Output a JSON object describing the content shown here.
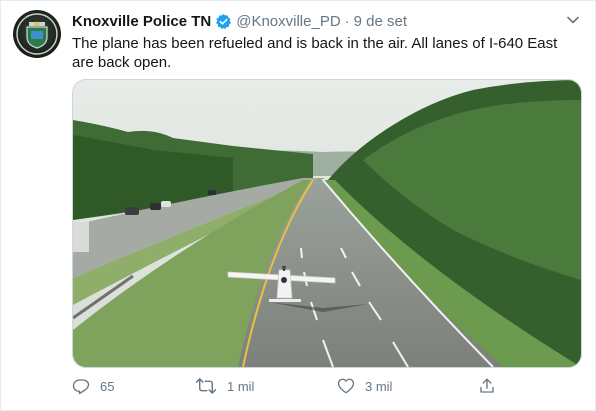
{
  "tweet": {
    "author_name": "Knoxville Police TN",
    "handle": "@Knoxville_PD",
    "separator": "·",
    "date": "9 de set",
    "text": "The plane has been refueled and is back in the air. All lanes of I-640 East are back open.",
    "verified": true
  },
  "media": {
    "kind": "photo",
    "subject": "small plane on highway"
  },
  "actions": {
    "reply_count": "65",
    "retweet_count": "1 mil",
    "like_count": "3 mil"
  },
  "colors": {
    "verified_blue": "#1da1f2",
    "muted_text": "#657786",
    "main_text": "#14171a"
  },
  "icons": [
    "reply-icon",
    "retweet-icon",
    "like-icon",
    "share-icon",
    "chevron-down-icon",
    "verified-badge-icon"
  ]
}
